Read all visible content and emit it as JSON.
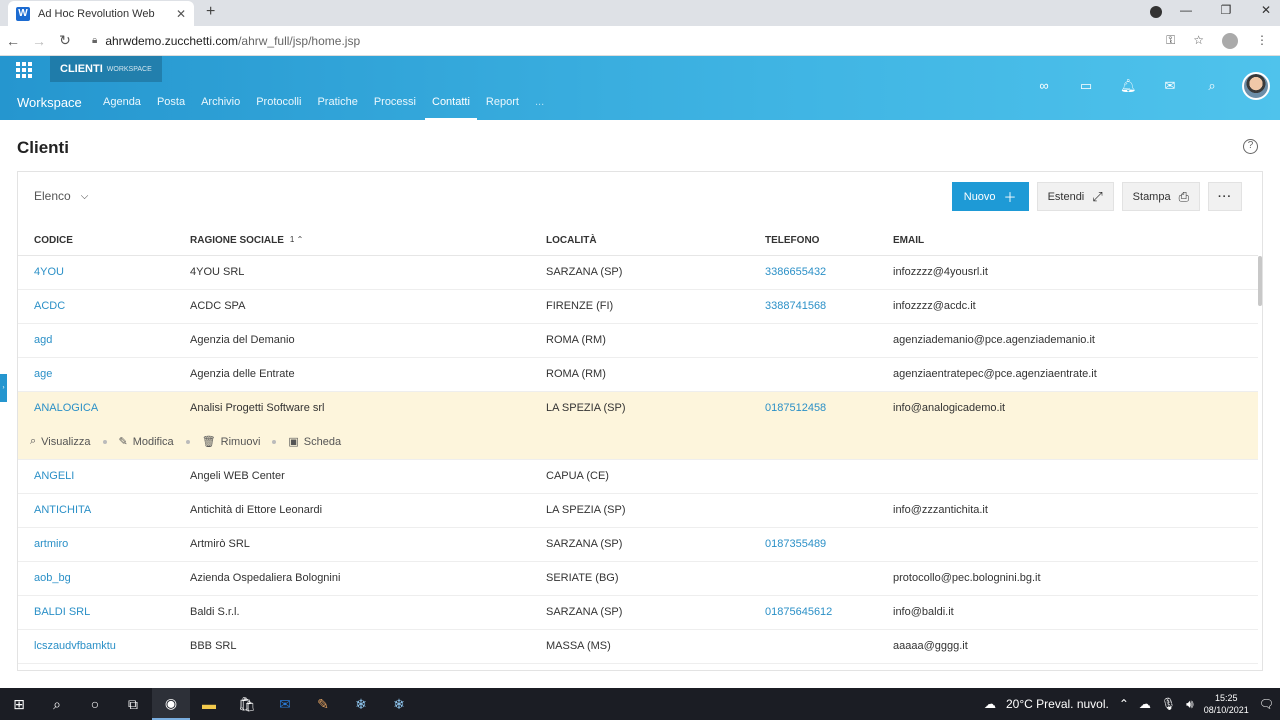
{
  "browser": {
    "tab_title": "Ad Hoc Revolution Web",
    "favicon_letter": "W",
    "url_host": "ahrwdemo.zucchetti.com",
    "url_path": "/ahrw_full/jsp/home.jsp"
  },
  "app": {
    "workspace_chip": "CLIENTI",
    "workspace_chip_sub": "WORKSPACE",
    "title": "Workspace",
    "nav": [
      "Agenda",
      "Posta",
      "Archivio",
      "Protocolli",
      "Pratiche",
      "Processi",
      "Contatti",
      "Report",
      "..."
    ],
    "active_nav": "Contatti",
    "colors": {
      "accent": "#1e9ad6",
      "link": "#2b90c7",
      "highlight_row": "#fdf5dc"
    }
  },
  "page": {
    "title": "Clienti",
    "view_label": "Elenco",
    "buttons": {
      "new": "Nuovo",
      "expand": "Estendi",
      "print": "Stampa"
    }
  },
  "table": {
    "headers": {
      "code": "CODICE",
      "name": "RAGIONE SOCIALE",
      "sort_index": "1",
      "location": "LOCALITÀ",
      "phone": "TELEFONO",
      "email": "EMAIL"
    },
    "rows": [
      {
        "code": "4YOU",
        "name": "4YOU SRL",
        "location": "SARZANA (SP)",
        "phone": "3386655432",
        "email": "infozzzz@4yousrl.it"
      },
      {
        "code": "ACDC",
        "name": "ACDC SPA",
        "location": "FIRENZE (FI)",
        "phone": "3388741568",
        "email": "infozzzz@acdc.it"
      },
      {
        "code": "agd",
        "name": "Agenzia del Demanio",
        "location": "ROMA (RM)",
        "phone": "",
        "email": "agenziademanio@pce.agenziademanio.it"
      },
      {
        "code": "age",
        "name": "Agenzia delle Entrate",
        "location": "ROMA (RM)",
        "phone": "",
        "email": "agenziaentratepec@pce.agenziaentrate.it"
      },
      {
        "code": "ANALOGICA",
        "name": "Analisi Progetti Software srl",
        "location": "LA SPEZIA (SP)",
        "phone": "0187512458",
        "email": "info@analogicademo.it"
      },
      {
        "code": "ANGELI",
        "name": "Angeli WEB Center",
        "location": "CAPUA (CE)",
        "phone": "",
        "email": ""
      },
      {
        "code": "ANTICHITA",
        "name": "Antichità di Ettore Leonardi",
        "location": "LA SPEZIA (SP)",
        "phone": "",
        "email": "info@zzzantichita.it"
      },
      {
        "code": "artmiro",
        "name": "Artmirò SRL",
        "location": "SARZANA (SP)",
        "phone": "0187355489",
        "email": ""
      },
      {
        "code": "aob_bg",
        "name": "Azienda Ospedaliera Bolognini",
        "location": "SERIATE (BG)",
        "phone": "",
        "email": "protocollo@pec.bolognini.bg.it"
      },
      {
        "code": "BALDI SRL",
        "name": "Baldi S.r.l.",
        "location": "SARZANA (SP)",
        "phone": "01875645612",
        "email": "info@baldi.it"
      },
      {
        "code": "lcszaudvfbamktu",
        "name": "BBB SRL",
        "location": "MASSA (MS)",
        "phone": "",
        "email": "aaaaa@gggg.it"
      }
    ],
    "row_actions": {
      "view": "Visualizza",
      "edit": "Modifica",
      "remove": "Rimuovi",
      "card": "Scheda"
    }
  },
  "taskbar": {
    "weather": "20°C  Preval. nuvol.",
    "time": "15:25",
    "date": "08/10/2021"
  }
}
